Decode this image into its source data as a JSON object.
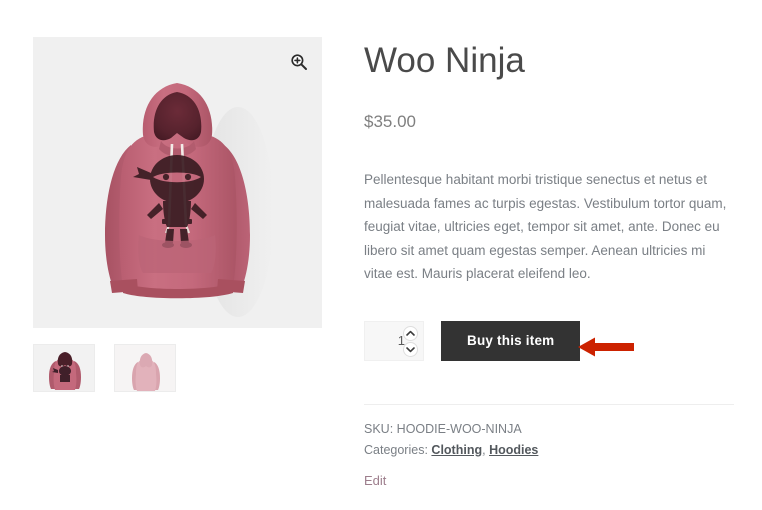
{
  "product": {
    "title": "Woo Ninja",
    "price": "$35.00",
    "description": "Pellentesque habitant morbi tristique senectus et netus et malesuada fames ac turpis egestas. Vestibulum tortor quam, feugiat vitae, ultricies eget, tempor sit amet, ante. Donec eu libero sit amet quam egestas semper. Aenean ultricies mi vitae est. Mauris placerat eleifend leo.",
    "sku_label": "SKU:",
    "sku_value": "HOODIE-WOO-NINJA",
    "categories_label": "Categories:",
    "categories": [
      {
        "label": "Clothing"
      },
      {
        "label": "Hoodies"
      }
    ],
    "categories_separator": ", ",
    "edit_label": "Edit"
  },
  "cart": {
    "quantity_value": "1",
    "quantity_placeholder": "1",
    "increase_icon": "chevron-up-icon",
    "decrease_icon": "chevron-down-icon",
    "buy_label": "Buy this item"
  },
  "gallery": {
    "zoom_icon": "magnifier-plus-icon",
    "main_image_alt": "Woo Ninja hoodie front view",
    "thumbnails": [
      {
        "alt": "Woo Ninja hoodie front"
      },
      {
        "alt": "Woo Ninja hoodie back"
      }
    ]
  },
  "annotation": {
    "arrow_icon": "left-arrow-icon",
    "arrow_color": "#cc2200"
  },
  "colors": {
    "hoodie_fabric": "#c4677c",
    "hoodie_lining": "#5a2530",
    "image_background": "#f0f0f0",
    "button_background": "#333333",
    "edit_link": "#9d7e8c",
    "text_body": "#7a7f85",
    "title": "#4a4a4a"
  }
}
